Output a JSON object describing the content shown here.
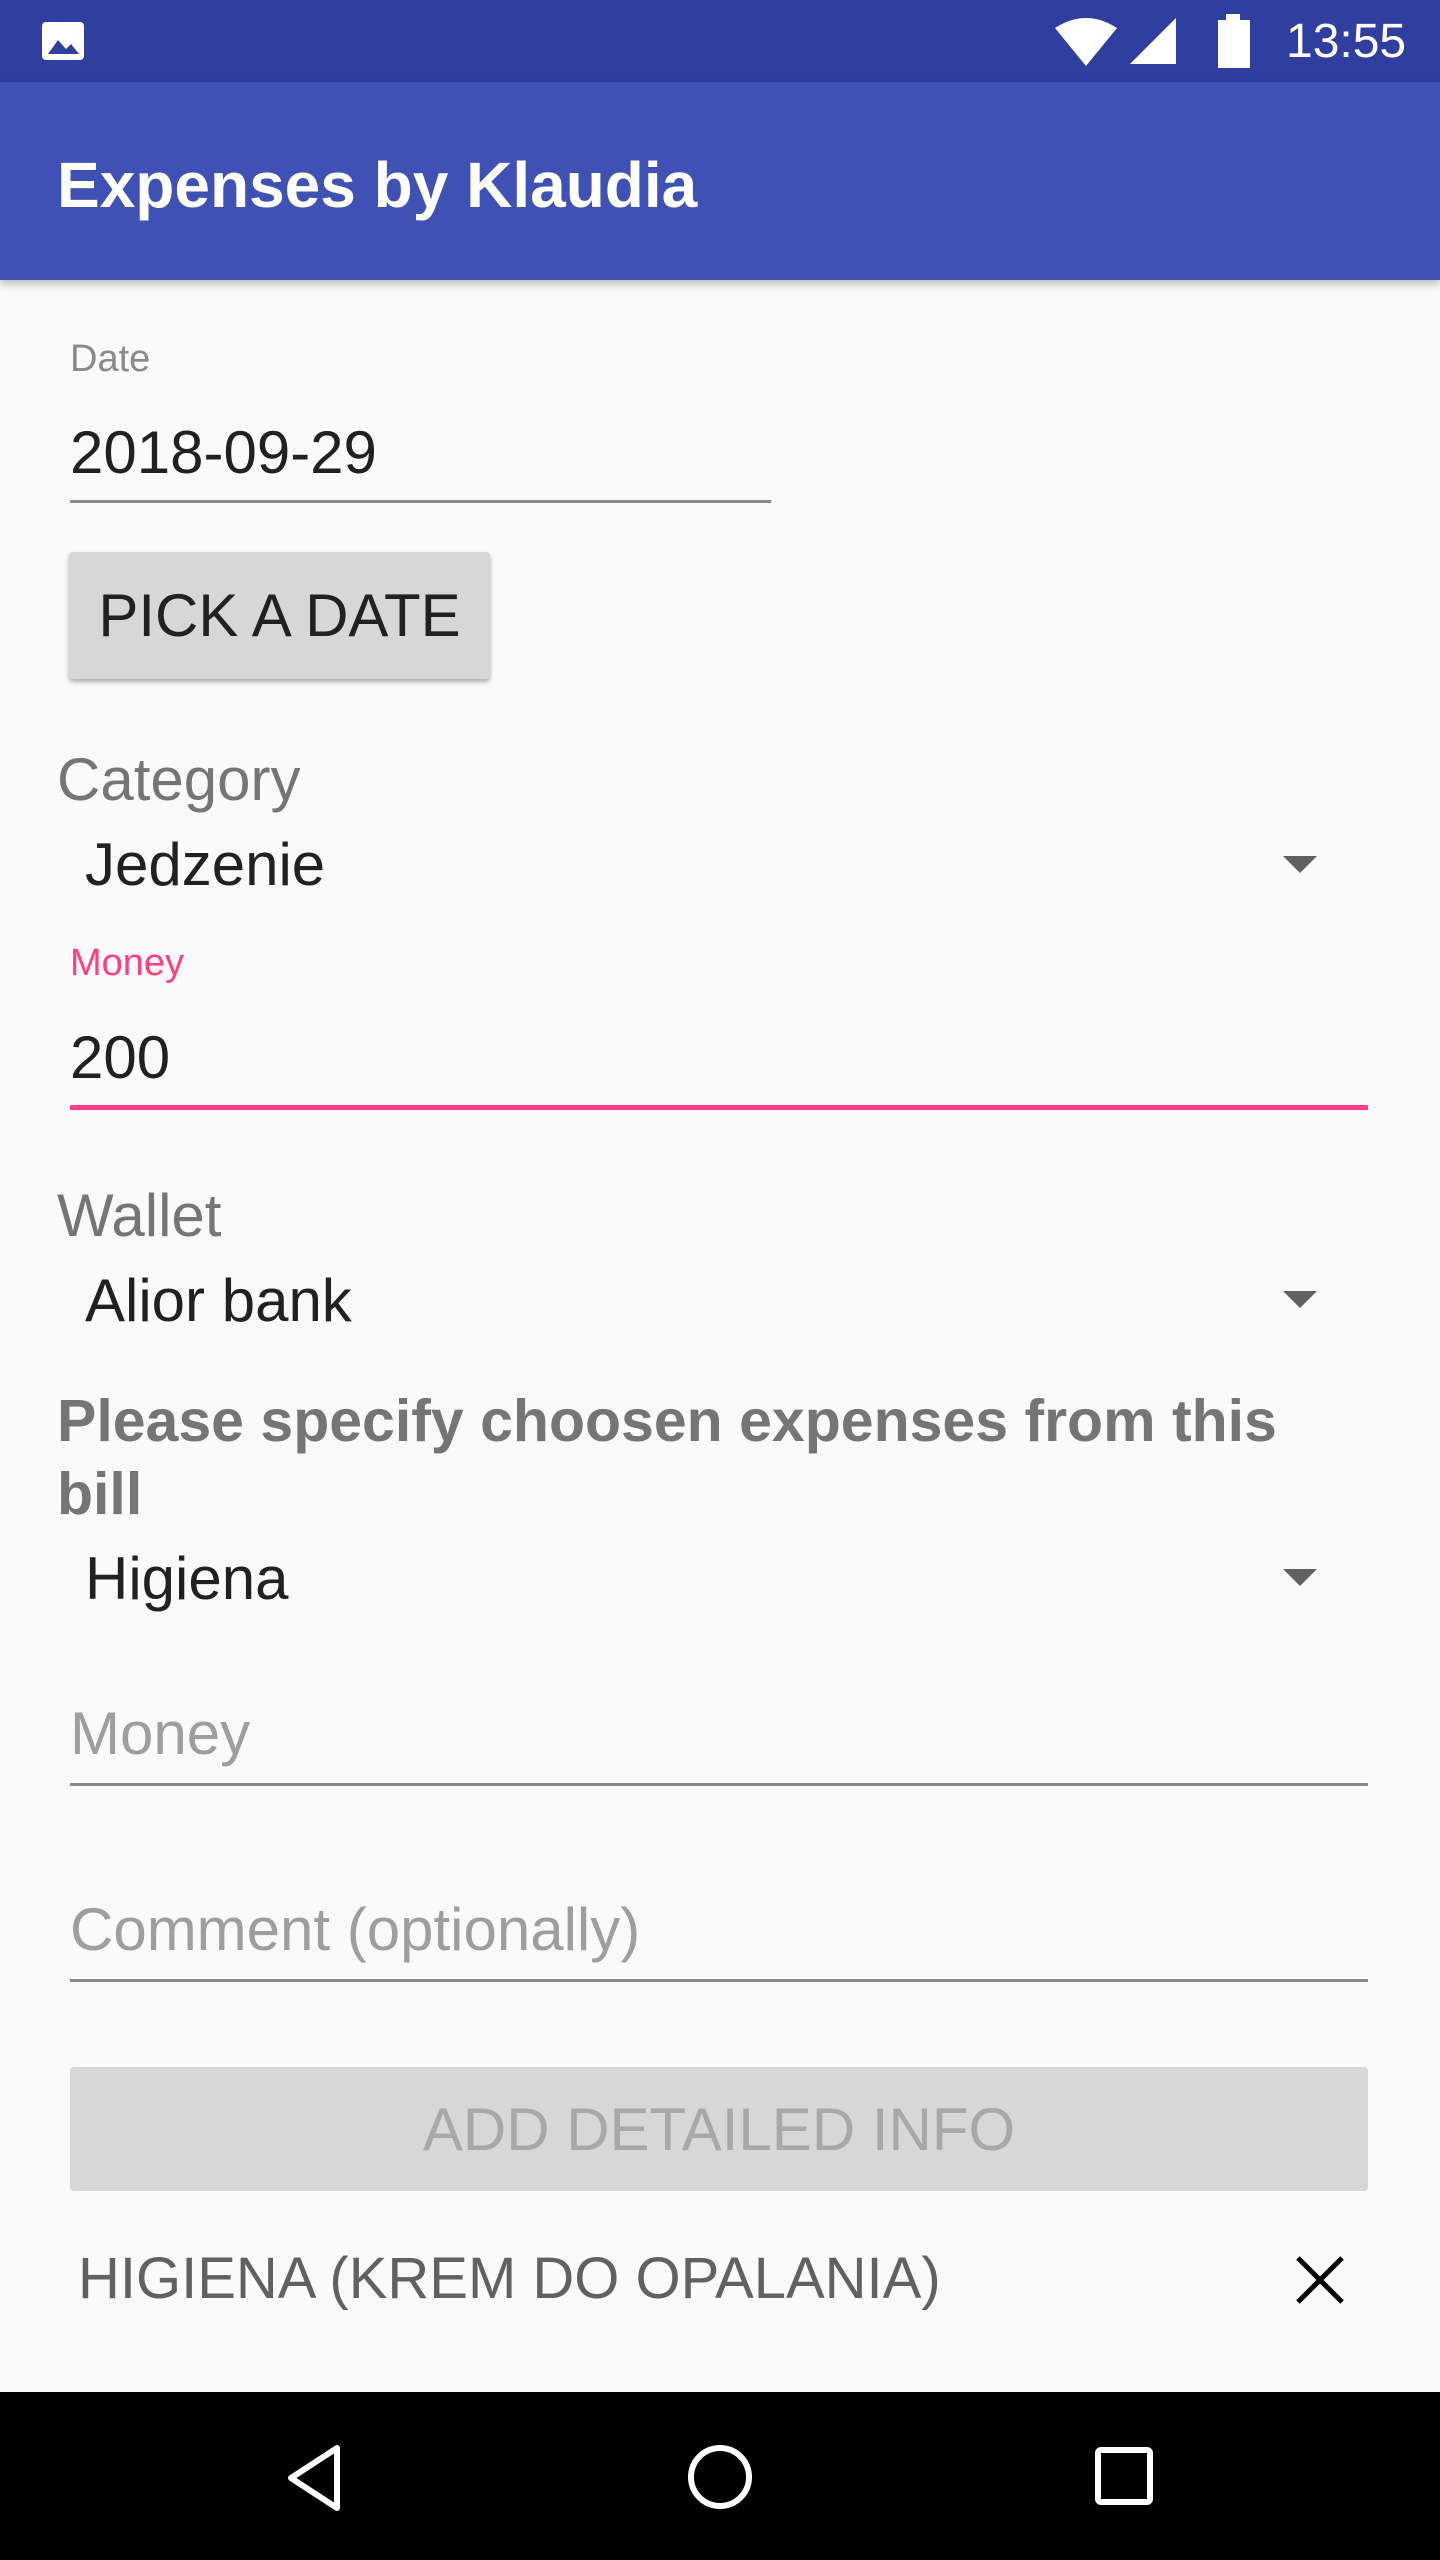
{
  "status_bar": {
    "time": "13:55",
    "icons": [
      "image-icon",
      "wifi-icon",
      "signal-icon",
      "battery-icon"
    ]
  },
  "app_bar": {
    "title": "Expenses by Klaudia"
  },
  "form": {
    "date_label": "Date",
    "date_value": "2018-09-29",
    "pick_date_button": "PICK A DATE",
    "category_label": "Category",
    "category_value": "Jedzenie",
    "money_label": "Money",
    "money_value": "200",
    "wallet_label": "Wallet",
    "wallet_value": "Alior bank",
    "specify_text": "Please specify choosen expenses from this bill",
    "detail_category_value": "Higiena",
    "detail_money_placeholder": "Money",
    "comment_placeholder": "Comment (optionally)",
    "add_detailed_button": "ADD DETAILED INFO"
  },
  "details_list": [
    {
      "text": "HIGIENA (KREM DO OPALANIA)"
    }
  ],
  "colors": {
    "primary": "#3F51B5",
    "primary_dark": "#303F9F",
    "accent": "#FF4081"
  }
}
